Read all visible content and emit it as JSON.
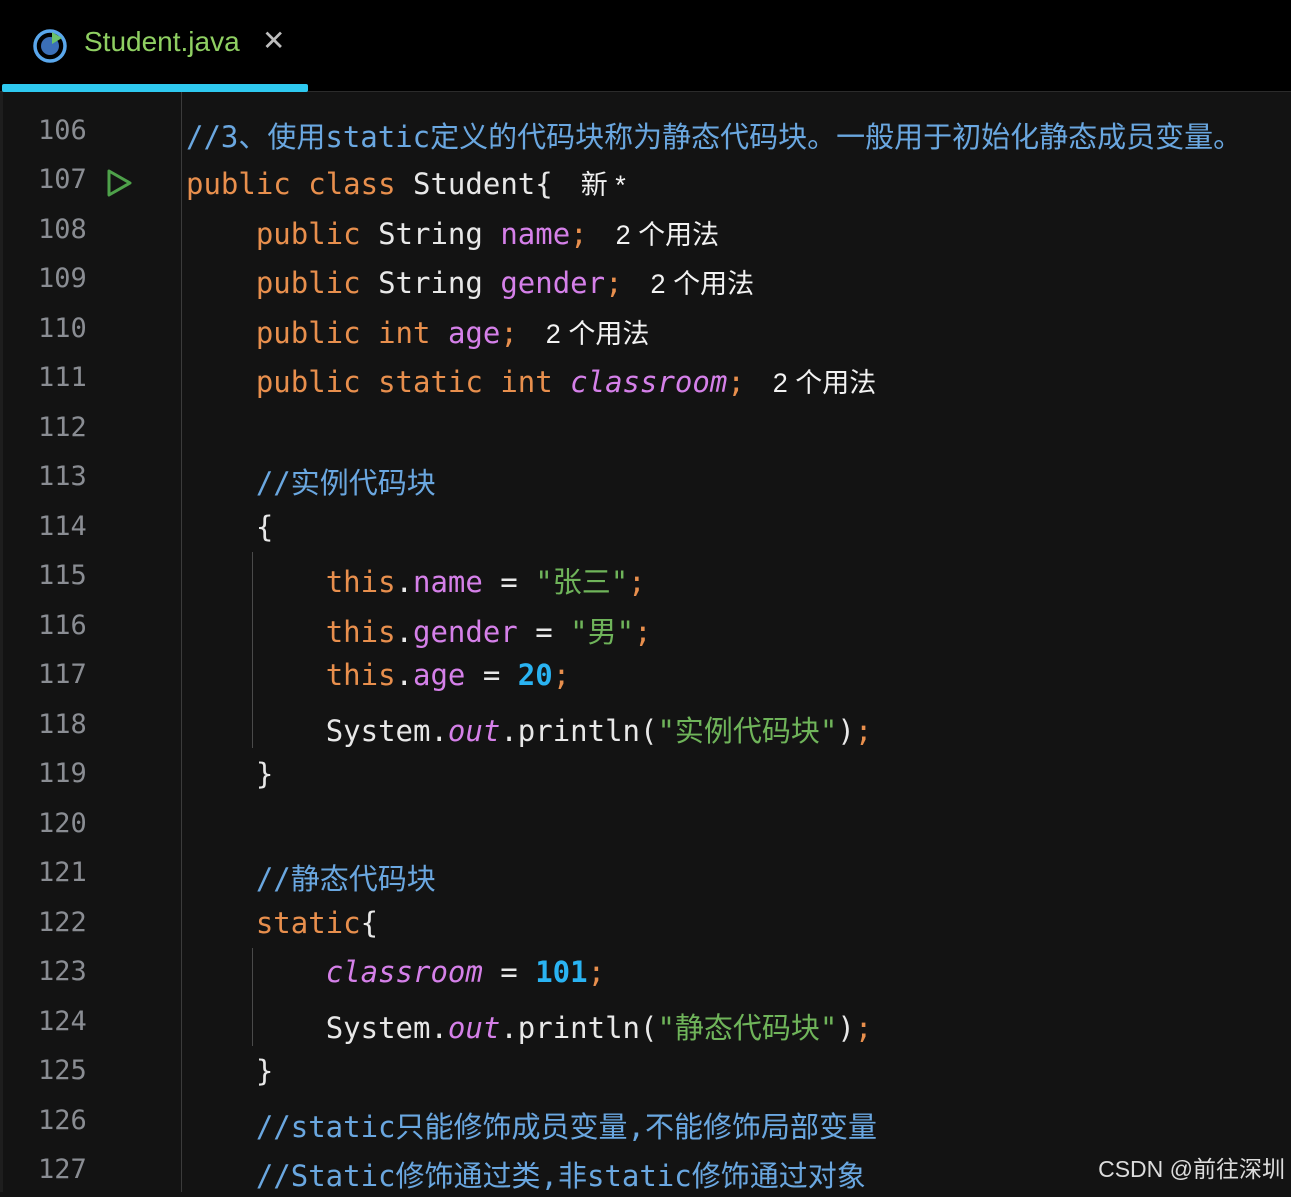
{
  "tab": {
    "filename": "Student.java",
    "close_glyph": "✕",
    "icon": "java-class-icon",
    "accent_color": "#2ec9f0"
  },
  "gutter": {
    "run_icon": "run-gutter-icon"
  },
  "lines": [
    {
      "num": "106",
      "code": "//3、使用static定义的代码块称为静态代码块。一般用于初始化静态成员变量。"
    },
    {
      "num": "107",
      "code": "public class Student{",
      "hint": "新 *"
    },
    {
      "num": "108",
      "code": "    public String name;",
      "hint": "2 个用法"
    },
    {
      "num": "109",
      "code": "    public String gender;",
      "hint": "2 个用法"
    },
    {
      "num": "110",
      "code": "    public int age;",
      "hint": "2 个用法"
    },
    {
      "num": "111",
      "code": "    public static int classroom;",
      "hint": "2 个用法"
    },
    {
      "num": "112",
      "code": ""
    },
    {
      "num": "113",
      "code": "    //实例代码块"
    },
    {
      "num": "114",
      "code": "    {"
    },
    {
      "num": "115",
      "code": "        this.name = \"张三\";"
    },
    {
      "num": "116",
      "code": "        this.gender = \"男\";"
    },
    {
      "num": "117",
      "code": "        this.age = 20;"
    },
    {
      "num": "118",
      "code": "        System.out.println(\"实例代码块\");"
    },
    {
      "num": "119",
      "code": "    }"
    },
    {
      "num": "120",
      "code": ""
    },
    {
      "num": "121",
      "code": "    //静态代码块"
    },
    {
      "num": "122",
      "code": "    static{"
    },
    {
      "num": "123",
      "code": "        classroom = 101;"
    },
    {
      "num": "124",
      "code": "        System.out.println(\"静态代码块\");"
    },
    {
      "num": "125",
      "code": "    }"
    },
    {
      "num": "126",
      "code": "    //static只能修饰成员变量,不能修饰局部变量"
    },
    {
      "num": "127",
      "code": "    //Static修饰通过类,非static修饰通过对象"
    }
  ],
  "watermark": "CSDN @前往深圳",
  "colors": {
    "keyword": "#e88f4d",
    "field": "#d580e9",
    "string": "#6fb45a",
    "number": "#2ab3f2",
    "comment": "#6aa7e0",
    "background": "#131313"
  }
}
